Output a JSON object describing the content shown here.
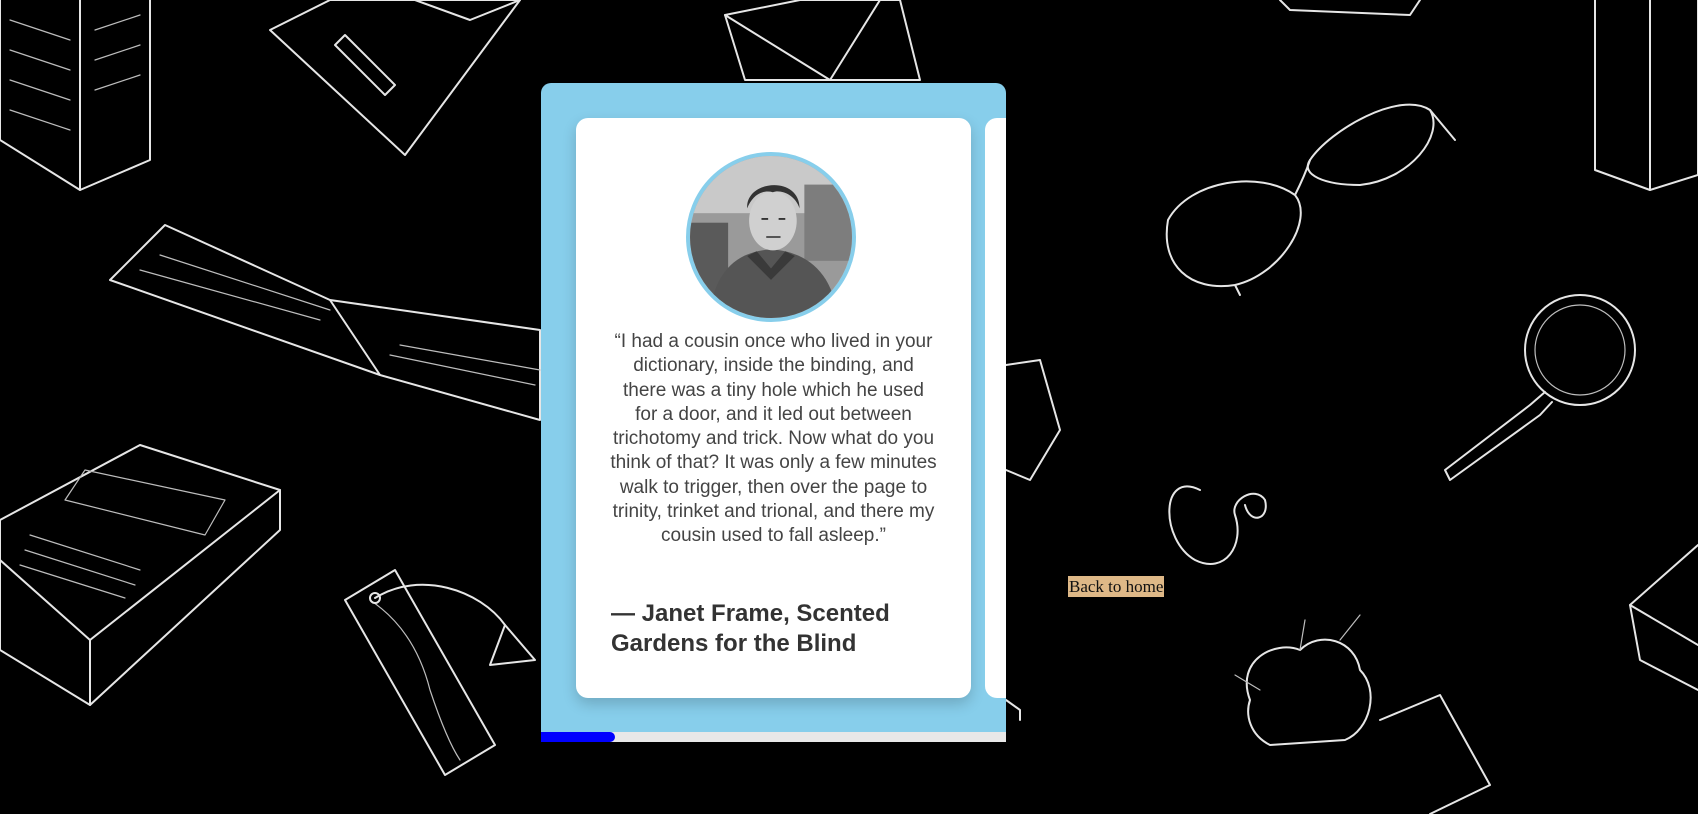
{
  "testimonial": {
    "quote": "“I had a cousin once who lived in your dictionary, inside the binding, and there was a tiny hole which he used for a door, and it led out between trichotomy and trick. Now what do you think of that? It was only a few minutes walk to trigger, then over the page to trinity, trinket and trional, and there my cousin used to fall asleep.”",
    "author": "— Janet Frame, Scented Gardens for the Blind"
  },
  "carousel": {
    "progress": 0.16
  },
  "nav": {
    "back_label": "Back to home"
  },
  "colors": {
    "background": "#000000",
    "carousel_bg": "#87ceeb",
    "card_bg": "#ffffff",
    "progress_fill": "#0000ff",
    "progress_track": "#e8e8e8",
    "back_link_bg": "#deb887"
  },
  "icons": [
    "book-illustration",
    "glasses-illustration",
    "magnifier-illustration",
    "bookmark-illustration",
    "cactus-illustration",
    "envelope-illustration"
  ]
}
